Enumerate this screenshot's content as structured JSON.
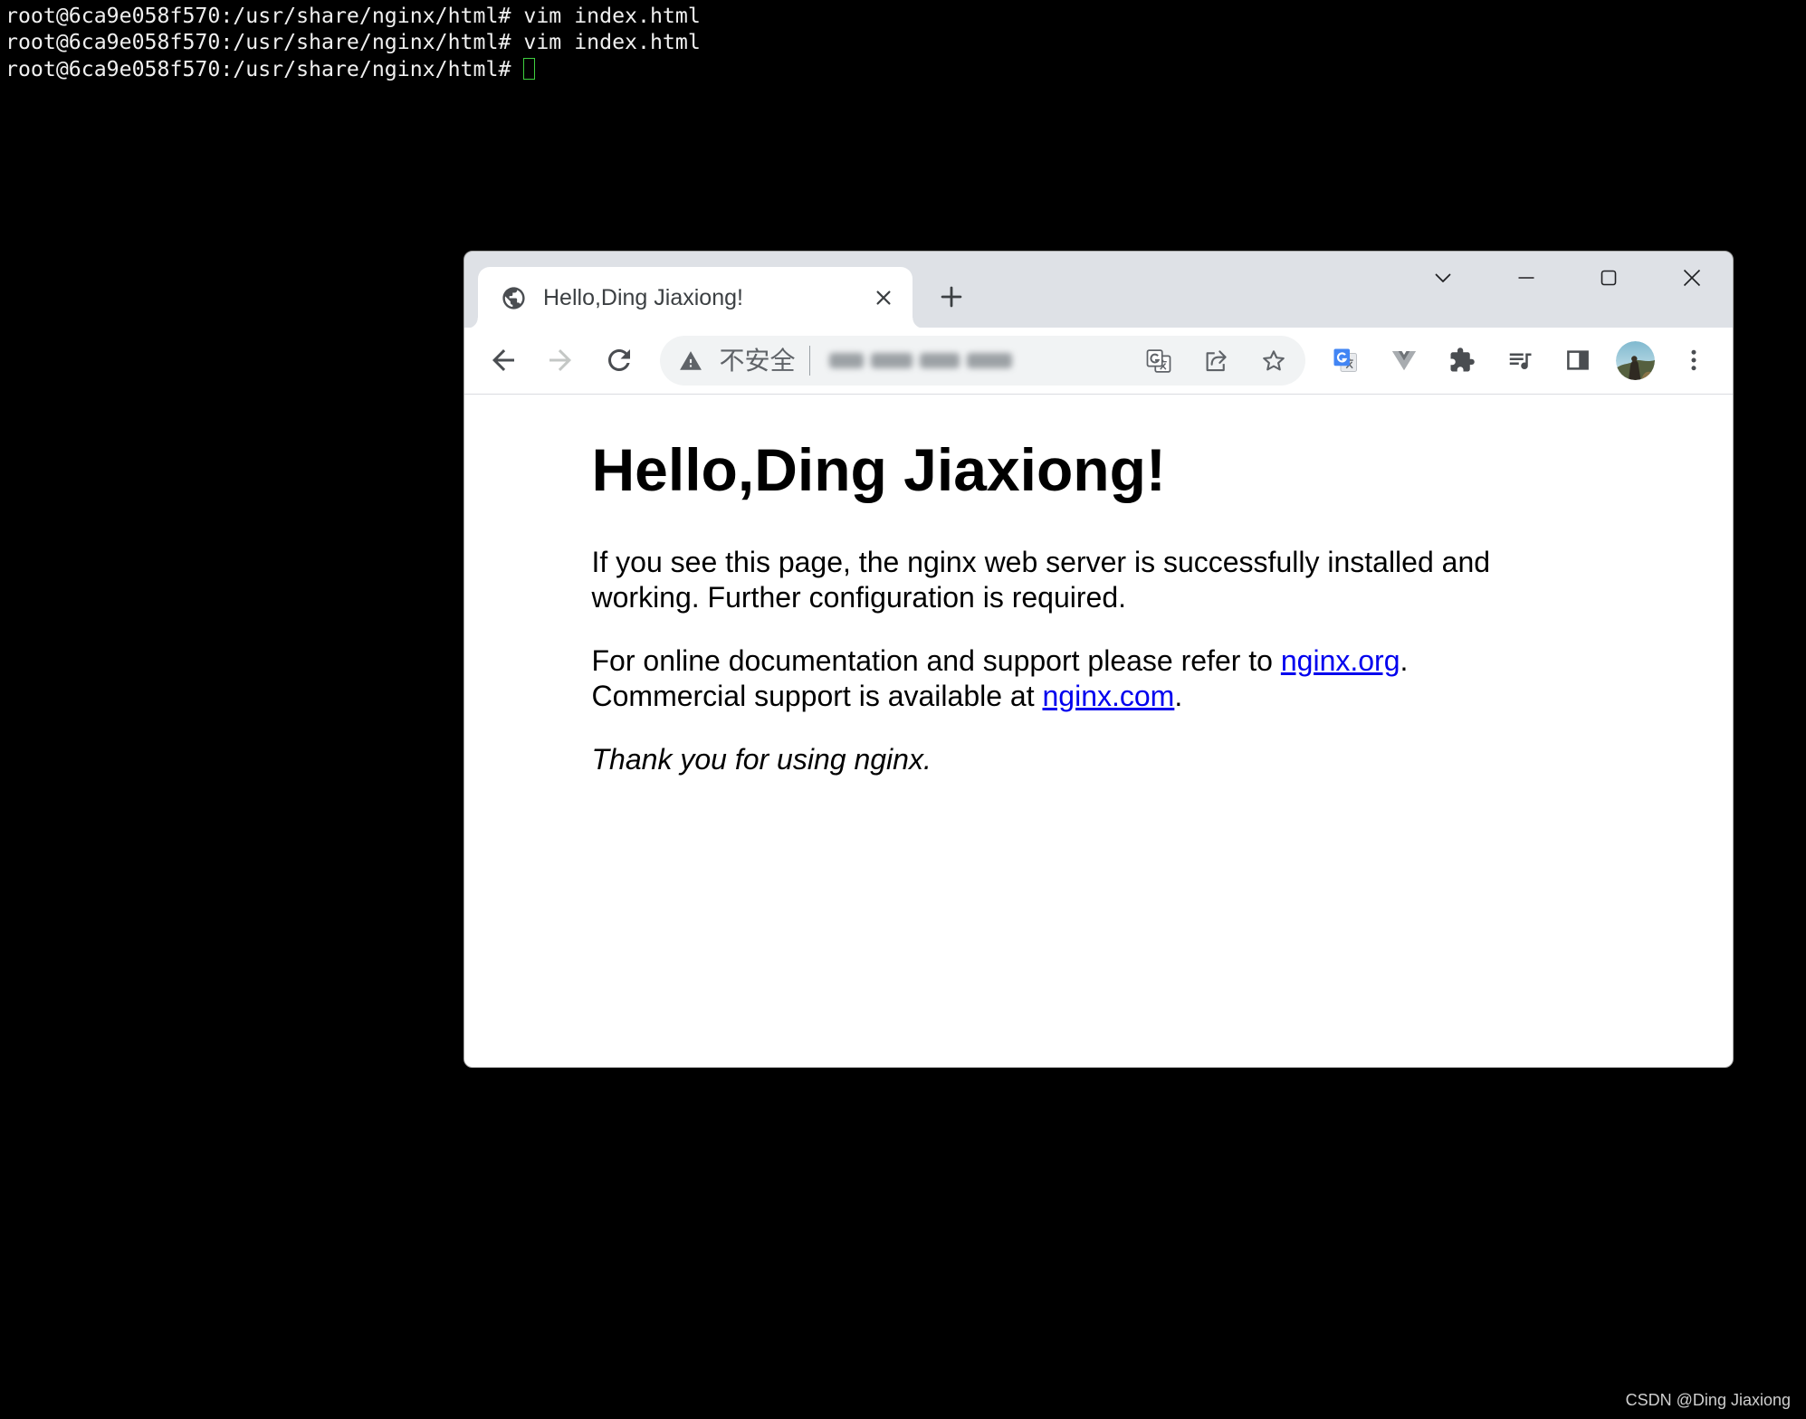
{
  "terminal": {
    "lines": [
      "root@6ca9e058f570:/usr/share/nginx/html# vim index.html",
      "root@6ca9e058f570:/usr/share/nginx/html# vim index.html",
      "root@6ca9e058f570:/usr/share/nginx/html# "
    ]
  },
  "browser": {
    "tab": {
      "title": "Hello,Ding Jiaxiong!",
      "favicon": "globe-icon",
      "close_icon": "close-icon"
    },
    "new_tab_icon": "plus-icon",
    "window_controls": [
      "chevron-down-icon",
      "minimize-icon",
      "maximize-icon",
      "close-icon"
    ],
    "navigation": {
      "back_icon": "arrow-back-icon",
      "forward_icon": "arrow-forward-icon",
      "forward_enabled": false,
      "reload_icon": "reload-icon"
    },
    "omnibox": {
      "security_icon": "warning-icon",
      "security_label": "不安全",
      "actions": [
        "translate-icon",
        "share-icon",
        "star-icon"
      ]
    },
    "extensions": [
      "google-translate-extension-icon",
      "vue-devtools-extension-icon",
      "puzzle-extensions-icon",
      "media-control-icon",
      "side-panel-icon",
      "profile-avatar",
      "kebab-menu-icon"
    ]
  },
  "page": {
    "heading": "Hello,Ding Jiaxiong!",
    "paragraph_1": [
      "If you see this page, the nginx web server is successfully installed and",
      "working. Further configuration is required."
    ],
    "paragraph_2": {
      "line_1_text": "For online documentation and support please refer to ",
      "line_1_link": "nginx.org",
      "line_1_end": ".",
      "line_2_text": "Commercial support is available at ",
      "line_2_link": "nginx.com",
      "line_2_end": "."
    },
    "paragraph_3": "Thank you for using nginx."
  },
  "watermark": "CSDN @Ding Jiaxiong",
  "colors": {
    "desktop_background": "#000000",
    "terminal_text": "#f0f0f0",
    "terminal_cursor": "#3fcf3f",
    "tab_strip": "#dee1e6",
    "toolbar": "#ffffff",
    "omnibox": "#f1f3f4",
    "link": "#0000ee",
    "icon": "#4a4d51",
    "watermark": "#cfcfcf"
  }
}
